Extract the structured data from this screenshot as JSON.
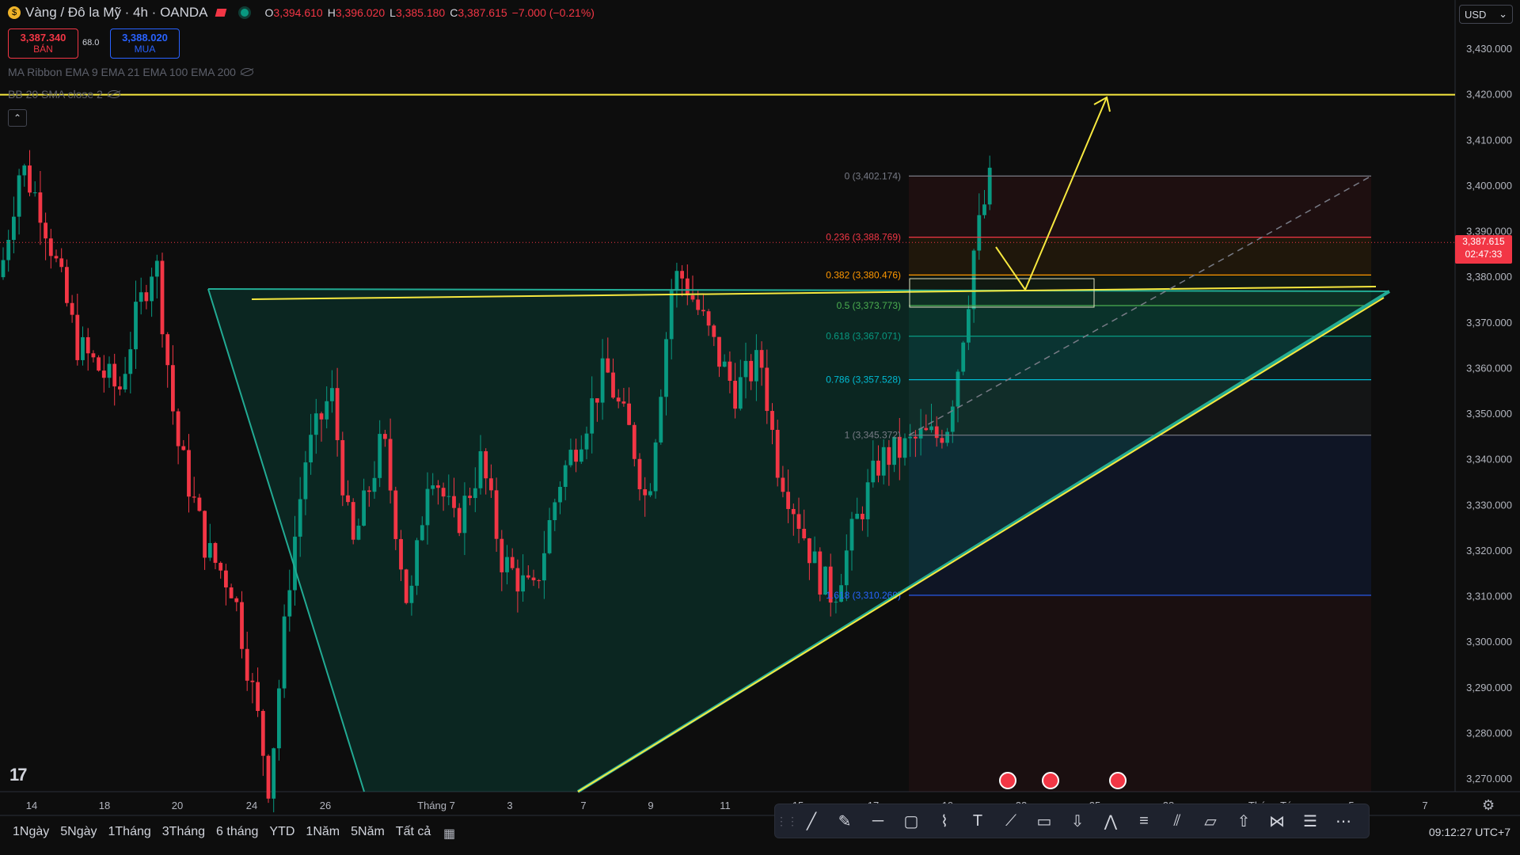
{
  "symbol": {
    "title": "Vàng / Đô la Mỹ · 4h · OANDA",
    "open_label": "O",
    "open": "3,394.610",
    "high_label": "H",
    "high": "3,396.020",
    "low_label": "L",
    "low": "3,385.180",
    "close_label": "C",
    "close": "3,387.615",
    "change": "−7.000 (−0.21%)"
  },
  "trade": {
    "sell_price": "3,387.340",
    "sell_label": "BÁN",
    "spread": "68.0",
    "buy_price": "3,388.020",
    "buy_label": "MUA"
  },
  "indicators": [
    "MA Ribbon EMA 9 EMA 21 EMA 100 EMA 200",
    "BB 20 SMA close 2"
  ],
  "currency": "USD",
  "current_price": {
    "price": "3,387.615",
    "countdown": "02:47:33"
  },
  "price_axis": [
    "3,430.000",
    "3,420.000",
    "3,410.000",
    "3,400.000",
    "3,390.000",
    "3,380.000",
    "3,370.000",
    "3,360.000",
    "3,350.000",
    "3,340.000",
    "3,330.000",
    "3,320.000",
    "3,310.000",
    "3,300.000",
    "3,290.000",
    "3,280.000",
    "3,270.000"
  ],
  "time_axis": [
    "14",
    "18",
    "20",
    "24",
    "26",
    "Tháng 7",
    "3",
    "7",
    "9",
    "11",
    "15",
    "17",
    "19",
    "22",
    "25",
    "28",
    "Tháng Tám",
    "5",
    "7"
  ],
  "fib_levels": [
    {
      "label": "0 (3,402.174)",
      "price": 3402.174,
      "color": "#787b86"
    },
    {
      "label": "0.236 (3,388.769)",
      "price": 3388.769,
      "color": "#f23645"
    },
    {
      "label": "0.382 (3,380.476)",
      "price": 3380.476,
      "color": "#ff9800"
    },
    {
      "label": "0.5 (3,373.773)",
      "price": 3373.773,
      "color": "#4caf50"
    },
    {
      "label": "0.618 (3,367.071)",
      "price": 3367.071,
      "color": "#089981"
    },
    {
      "label": "0.786 (3,357.528)",
      "price": 3357.528,
      "color": "#00bcd4"
    },
    {
      "label": "1 (3,345.372)",
      "price": 3345.372,
      "color": "#787b86"
    },
    {
      "label": "1.618 (3,310.269)",
      "price": 3310.269,
      "color": "#2962ff"
    }
  ],
  "resistance_price": 3420.0,
  "time_ranges": [
    "1Ngày",
    "5Ngày",
    "1Tháng",
    "3Tháng",
    "6 tháng",
    "YTD",
    "1Năm",
    "5Năm",
    "Tất cả"
  ],
  "bottom_time": "09:12:27 UTC+7",
  "drawing_tools": [
    "trend-line-icon",
    "brush-icon",
    "horizontal-line-icon",
    "rectangle-icon",
    "path-icon",
    "text-icon",
    "ray-icon",
    "callout-icon",
    "arrow-down-icon",
    "pattern-icon",
    "fib-icon",
    "fib-channel-icon",
    "comment-icon",
    "arrow-up-icon",
    "xabcd-icon",
    "settings-lines-icon",
    "more-lines-icon"
  ],
  "colors": {
    "up": "#089981",
    "down": "#f23645",
    "yellow": "#f7e83f",
    "bg": "#0d0d0d"
  }
}
